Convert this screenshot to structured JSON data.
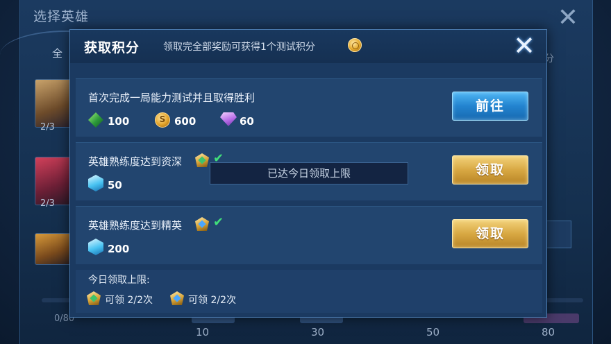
{
  "background": {
    "title": "选择英雄",
    "tab_partial": "全",
    "right_tab_partial": "分",
    "hero_counts": [
      "2/3",
      "2/3"
    ],
    "progress_label": "0/80",
    "milestones": [
      "10",
      "30",
      "50",
      "80"
    ]
  },
  "modal": {
    "title": "获取积分",
    "subtitle": "领取完全部奖励可获得1个测试积分",
    "coin_icon": "test-point-coin-icon",
    "close_icon": "close-icon"
  },
  "tasks": [
    {
      "title": "首次完成一局能力测试并且取得胜利",
      "rewards": [
        {
          "icon": "green-gem-icon",
          "value": "100"
        },
        {
          "icon": "gold-coin-icon",
          "value": "600"
        },
        {
          "icon": "purple-diamond-icon",
          "value": "60"
        }
      ],
      "button": "前往",
      "button_style": "blue"
    },
    {
      "title": "英雄熟练度达到资深",
      "badge_icon": "senior-badge-icon",
      "check_icon": "check-icon",
      "rewards": [
        {
          "icon": "blue-crystal-icon",
          "value": "50"
        }
      ],
      "button": "领取",
      "button_style": "gold"
    },
    {
      "title": "英雄熟练度达到精英",
      "badge_icon": "elite-badge-icon",
      "check_icon": "check-icon",
      "rewards": [
        {
          "icon": "blue-crystal-icon",
          "value": "200"
        }
      ],
      "button": "领取",
      "button_style": "gold"
    }
  ],
  "daily_limit": {
    "title": "今日领取上限:",
    "items": [
      {
        "icon": "senior-badge-icon",
        "text": "可领 2/2次"
      },
      {
        "icon": "elite-badge-icon",
        "text": "可领 2/2次"
      }
    ]
  },
  "toast": {
    "text": "已达今日领取上限"
  }
}
